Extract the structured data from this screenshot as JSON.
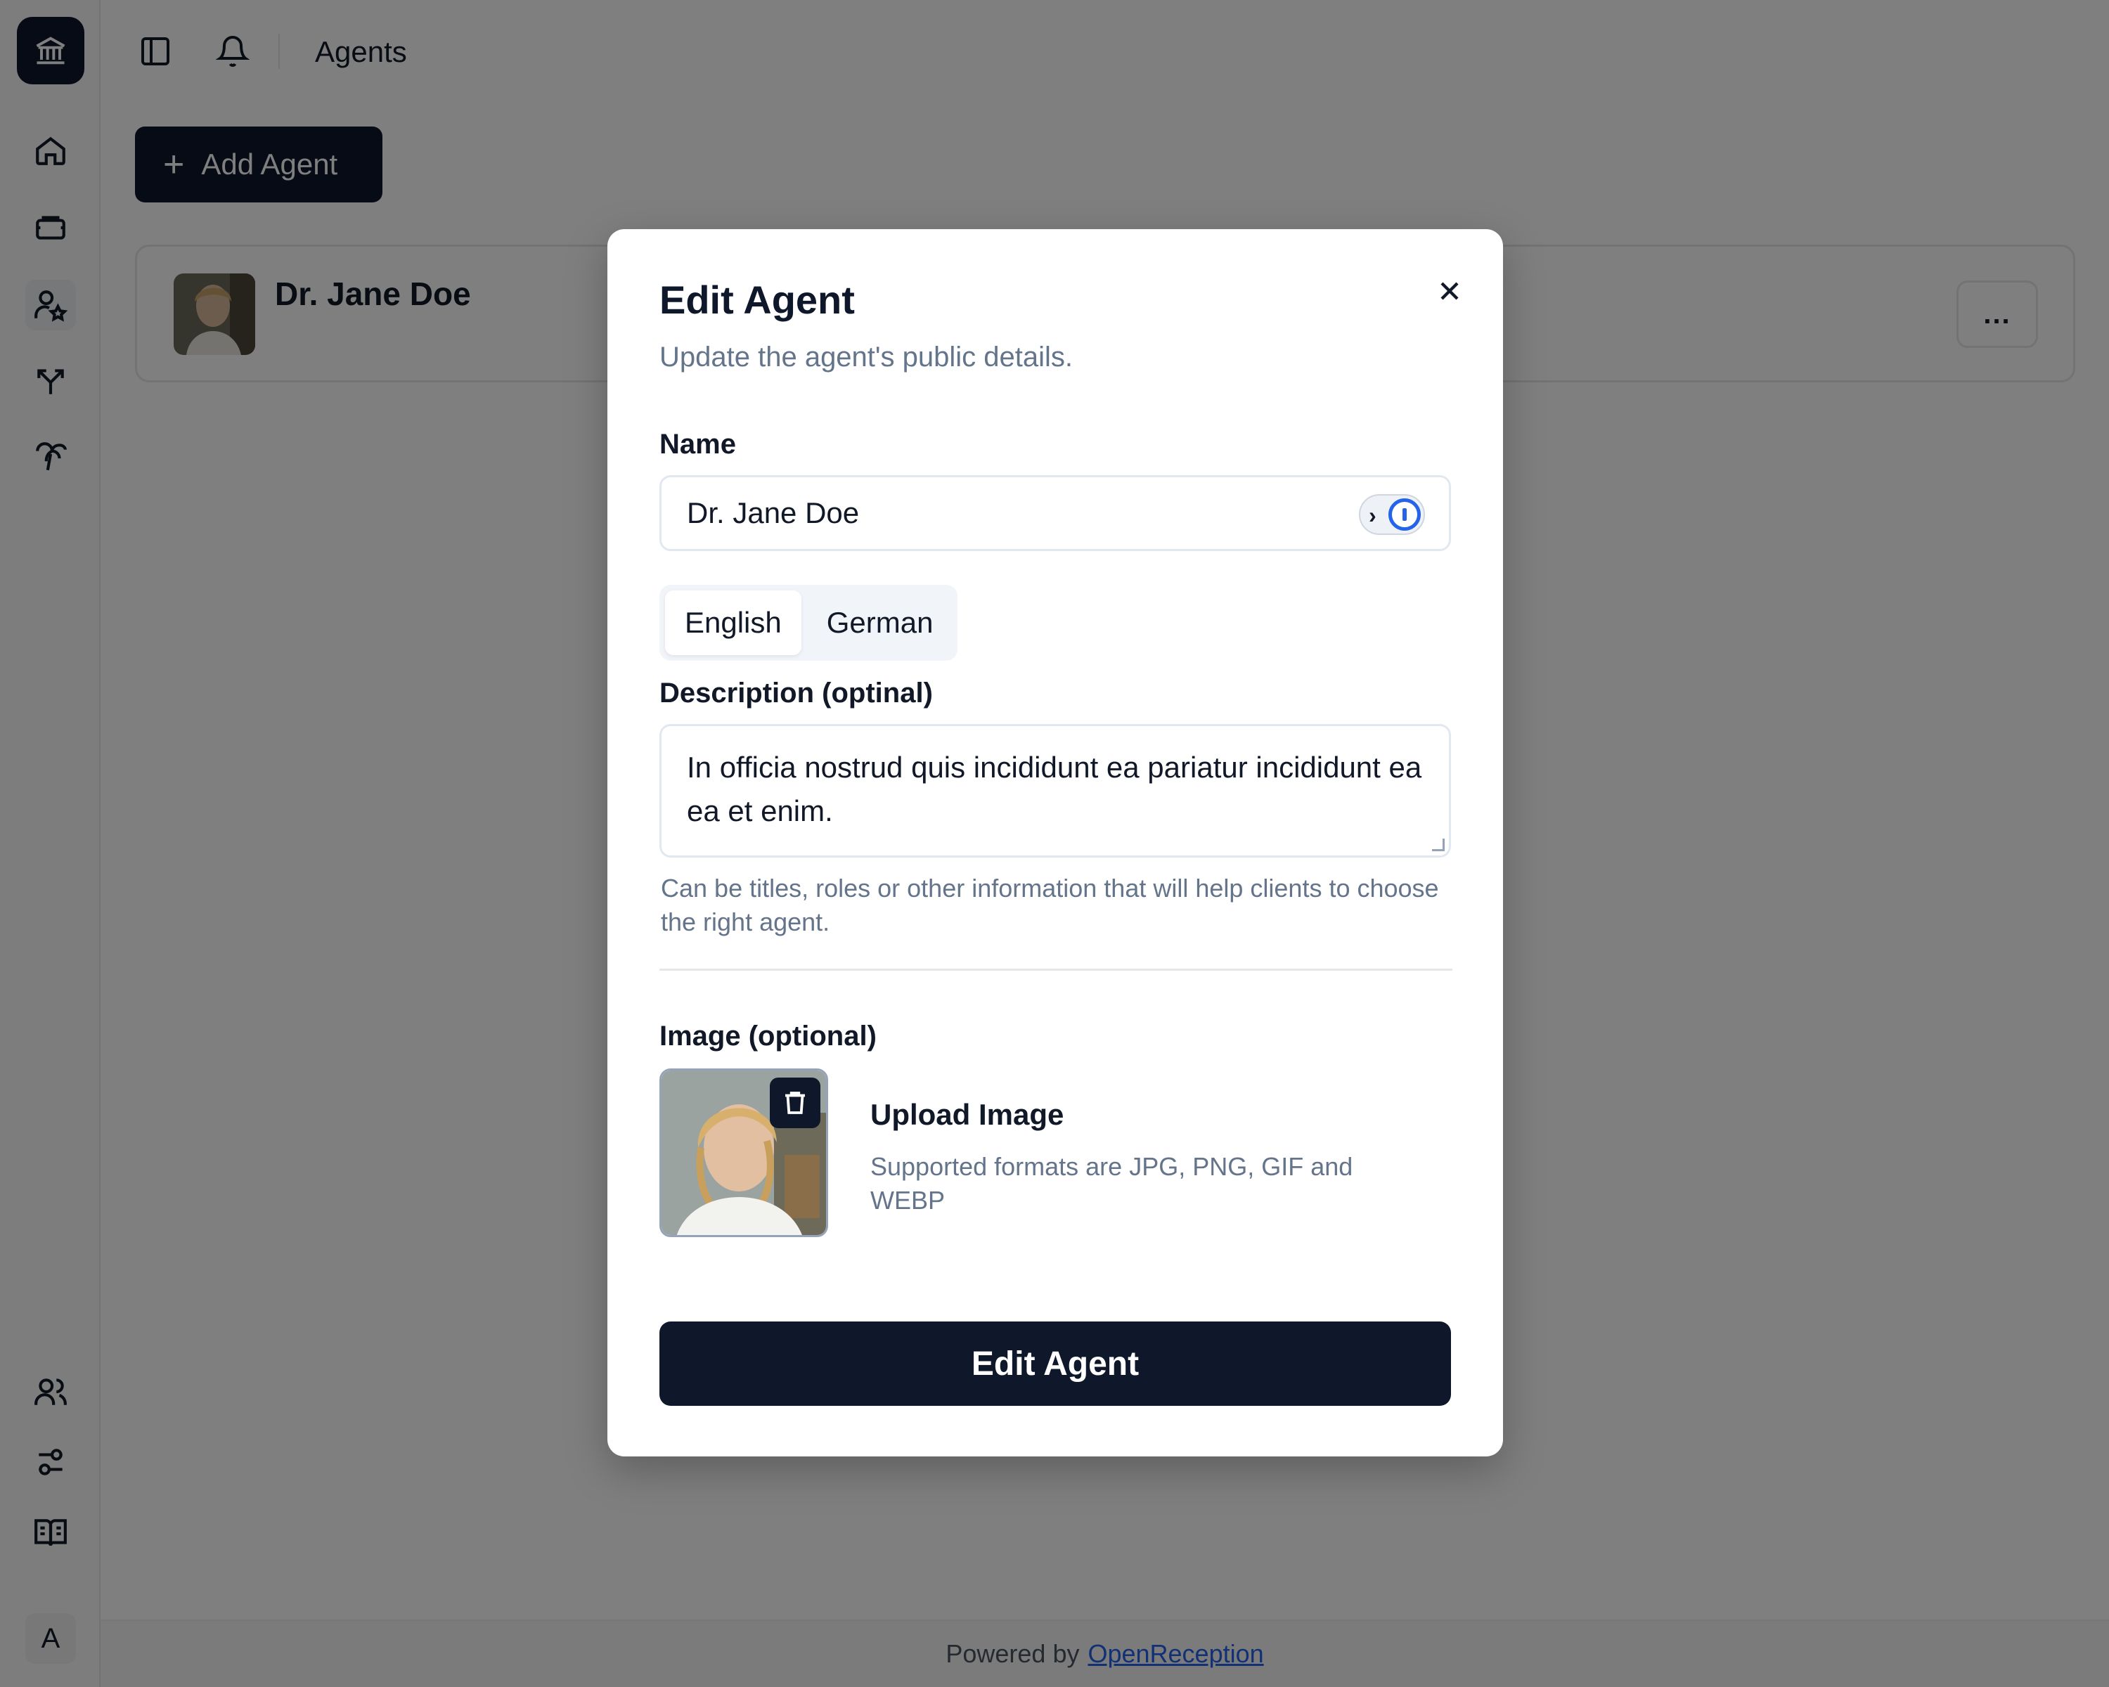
{
  "app": {
    "logo_icon": "bank-building-icon"
  },
  "sidebar": {
    "items": [
      {
        "icon": "home-icon"
      },
      {
        "icon": "ticket-icon"
      },
      {
        "icon": "user-star-icon"
      },
      {
        "icon": "split-arrows-icon"
      },
      {
        "icon": "palm-tree-icon"
      }
    ],
    "bottom_items": [
      {
        "icon": "users-icon"
      },
      {
        "icon": "sliders-icon"
      },
      {
        "icon": "book-icon"
      }
    ],
    "account_initial": "A"
  },
  "topbar": {
    "breadcrumb": "Agents"
  },
  "page": {
    "add_button_label": "Add Agent",
    "agents": [
      {
        "name": "Dr. Jane Doe"
      }
    ],
    "more_label": "..."
  },
  "footer": {
    "prefix": "Powered by",
    "link": "OpenReception"
  },
  "modal": {
    "title": "Edit Agent",
    "subtitle": "Update the agent's public details.",
    "name_label": "Name",
    "name_value": "Dr. Jane Doe",
    "tabs": [
      "English",
      "German"
    ],
    "active_tab": "English",
    "description_label": "Description (optinal)",
    "description_value": "In officia nostrud quis incididunt ea pariatur incididunt ea ea et enim.",
    "description_help": "Can be titles, roles or other information that will help clients to choose the right agent.",
    "image_label": "Image (optional)",
    "upload_title": "Upload Image",
    "upload_help": "Supported formats are JPG, PNG, GIF and WEBP",
    "submit_label": "Edit Agent"
  },
  "colors": {
    "primary": "#0f172a",
    "muted_text": "#64748b",
    "link": "#2563eb"
  }
}
